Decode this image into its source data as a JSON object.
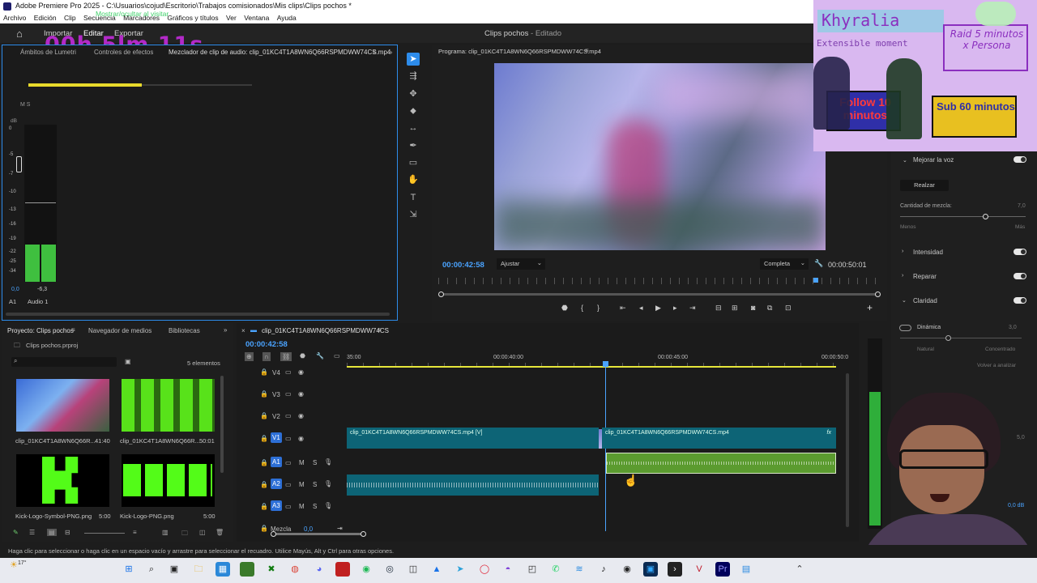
{
  "window": {
    "title": "Adobe Premiere Pro 2025 - C:\\Usuarios\\cojud\\Escritorio\\Trabajos comisionados\\Mis clips\\Clips pochos *"
  },
  "menu": [
    "Archivo",
    "Edición",
    "Clip",
    "Secuencia",
    "Marcadores",
    "Gráficos y títulos",
    "Ver",
    "Ventana",
    "Ayuda"
  ],
  "appbar": {
    "import": "Importar",
    "edit": "Editar",
    "export": "Exportar",
    "doc_title": "Clips pochos",
    "doc_state": "- Editado"
  },
  "overlay": {
    "timer": "00h 5lm 11s",
    "status_green": "Mostrar/ocultar al visitar"
  },
  "audio_mixer": {
    "tabs": [
      "Ámbitos de Lumetri",
      "Controles de efectos",
      "Mezclador de clip de audio: clip_01KC4T1A8WN6Q66RSPMDWW74CS.mp4"
    ],
    "db_label": "dB",
    "scale": [
      "0",
      "-1",
      "-5",
      "-7",
      "-10",
      "-13",
      "-16",
      "-19",
      "-22",
      "-25",
      "-28",
      "-34",
      "-40"
    ],
    "value_left": "0,0",
    "value_right": "-6,3",
    "track_id": "A1",
    "track_name": "Audio 1",
    "ms": "M  S"
  },
  "program": {
    "title": "Programa: clip_01KC4T1A8WN6Q66RSPMDWW74CS.mp4",
    "timecode": "00:00:42:58",
    "fit": "Ajustar",
    "quality": "Completa",
    "duration": "00:00:50:01"
  },
  "stream_overlay": {
    "name": "Khyralia",
    "tagline": "Extensible moment",
    "raid": "Raid 5 minutos x Persona",
    "follow": "Follow 10 minutos",
    "sub": "Sub 60 minutos"
  },
  "effects": {
    "enhance_speech": "Mejorar la voz",
    "enhance_btn": "Realzar",
    "mix_amount": "Cantidad de mezcla:",
    "mix_value": "7,0",
    "less": "Menos",
    "more": "Más",
    "loudness": "Intensidad",
    "repair": "Reparar",
    "clarity": "Claridad",
    "dynamics": "Dinámica",
    "dynamics_value": "3,0",
    "natural": "Natural",
    "focused": "Concentrado",
    "reanalyze": "Volver a analizar",
    "value_50": "5,0",
    "db_value": "0,0 dB"
  },
  "project": {
    "tabs": [
      "Proyecto: Clips pochos",
      "Navegador de medios",
      "Bibliotecas"
    ],
    "file": "Clips pochos.prproj",
    "count": "5 elementos",
    "items": [
      {
        "name": "clip_01KC4T1A8WN6Q66R...",
        "dur": "41:40"
      },
      {
        "name": "clip_01KC4T1A8WN6Q66R...",
        "dur": "50:01"
      },
      {
        "name": "Kick-Logo-Symbol-PNG.png",
        "dur": "5:00"
      },
      {
        "name": "Kick-Logo-PNG.png",
        "dur": "5:00"
      }
    ]
  },
  "timeline": {
    "tab": "clip_01KC4T1A8WN6Q66RSPMDWW74CS",
    "timecode": "00:00:42:58",
    "ruler": [
      "35:00",
      "00:00:40:00",
      "00:00:45:00",
      "00:00:50:0"
    ],
    "tracks_video": [
      "V4",
      "V3",
      "V2",
      "V1"
    ],
    "tracks_audio": [
      "A1",
      "A2",
      "A3"
    ],
    "mix": "Mezcla",
    "mix_value": "0,0",
    "clip_v1a": "clip_01KC4T1A8WN6Q66RSPMDWW74CS.mp4 [V]",
    "clip_v1b": "clip_01KC4T1A8WN6Q66RSPMDWW74CS.mp4",
    "fx": "fx"
  },
  "status_bar": "Haga clic para seleccionar o haga clic en un espacio vacío y arrastre para seleccionar el recuadro. Utilice Mayús, Alt y Ctrl para otras opciones.",
  "taskbar": {
    "temp": "17°"
  },
  "colors": {
    "accent": "#2d8ceb",
    "timecode": "#4aa3ff",
    "v_clip": "#0d6476",
    "a1_clip": "#5b9b2f",
    "ruler_work": "#e6e63a"
  }
}
